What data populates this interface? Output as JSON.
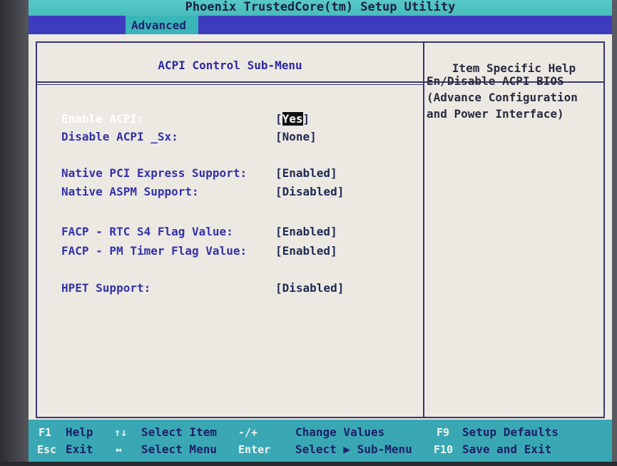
{
  "app_title": "Phoenix TrustedCore(tm) Setup Utility",
  "menu": {
    "active_tab": "Advanced"
  },
  "submenu": {
    "title": "ACPI Control Sub-Menu"
  },
  "help": {
    "title": "Item Specific Help",
    "lines": [
      "En/Disable ACPI BIOS",
      "(Advance Configuration",
      "and Power Interface)"
    ]
  },
  "settings": [
    {
      "label": "Enable ACPI:",
      "value_open": "[",
      "value_hl": "Yes",
      "value_close": "]",
      "selected": true
    },
    {
      "label": "Disable ACPI _Sx:",
      "value": "[None]"
    },
    {
      "label": "Native PCI Express Support:",
      "value": "[Enabled]"
    },
    {
      "label": "Native ASPM Support:",
      "value": "[Disabled]"
    },
    {
      "label": "FACP - RTC S4 Flag Value:",
      "value": "[Enabled]"
    },
    {
      "label": "FACP - PM Timer Flag Value:",
      "value": "[Enabled]"
    },
    {
      "label": "HPET Support:",
      "value": "[Disabled]"
    }
  ],
  "footer": {
    "row1": [
      {
        "key": "F1",
        "desc": "Help"
      },
      {
        "key": "↑↓",
        "desc": "Select Item"
      },
      {
        "key": "-/+",
        "desc": "Change Values"
      },
      {
        "key": "F9",
        "desc": "Setup Defaults"
      }
    ],
    "row2": [
      {
        "key": "Esc",
        "desc": "Exit"
      },
      {
        "key": "↔",
        "desc": "Select Menu"
      },
      {
        "key": "Enter",
        "desc": "Select ▶ Sub-Menu"
      },
      {
        "key": "F10",
        "desc": "Save and Exit"
      }
    ]
  }
}
